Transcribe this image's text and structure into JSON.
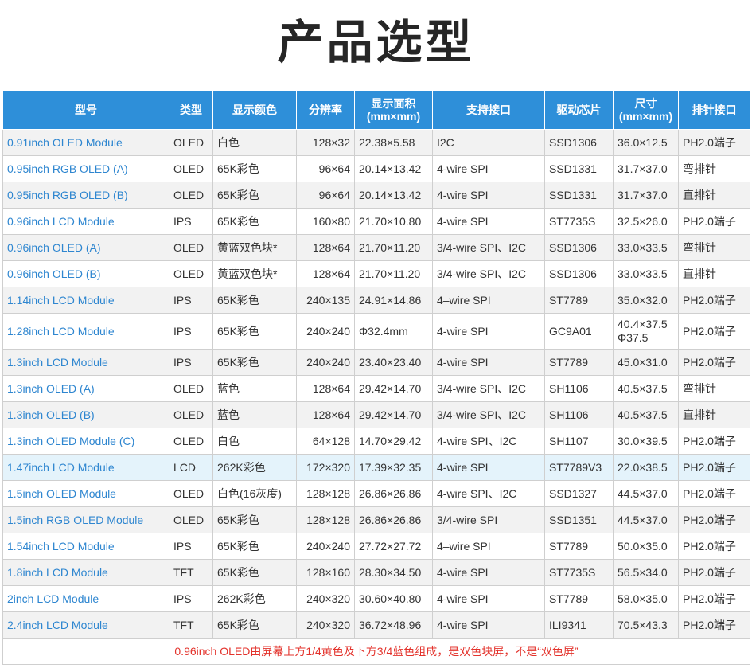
{
  "title": "产品选型",
  "table": {
    "headers": [
      {
        "line1": "型号",
        "line2": ""
      },
      {
        "line1": "类型",
        "line2": ""
      },
      {
        "line1": "显示颜色",
        "line2": ""
      },
      {
        "line1": "分辨率",
        "line2": ""
      },
      {
        "line1": "显示面积",
        "line2": "(mm×mm)"
      },
      {
        "line1": "支持接口",
        "line2": ""
      },
      {
        "line1": "驱动芯片",
        "line2": ""
      },
      {
        "line1": "尺寸",
        "line2": "(mm×mm)"
      },
      {
        "line1": "排针接口",
        "line2": ""
      }
    ],
    "rows": [
      {
        "model": "0.91inch OLED Module",
        "type": "OLED",
        "color": "白色",
        "resolution": "128×32",
        "area": "22.38×5.58",
        "interface": "I2C",
        "driver": "SSD1306",
        "size": "36.0×12.5",
        "connector": "PH2.0端子"
      },
      {
        "model": "0.95inch RGB OLED (A)",
        "type": "OLED",
        "color": "65K彩色",
        "resolution": "96×64",
        "area": "20.14×13.42",
        "interface": "4-wire SPI",
        "driver": "SSD1331",
        "size": "31.7×37.0",
        "connector": "弯排针"
      },
      {
        "model": "0.95inch RGB OLED (B)",
        "type": "OLED",
        "color": "65K彩色",
        "resolution": "96×64",
        "area": "20.14×13.42",
        "interface": "4-wire SPI",
        "driver": "SSD1331",
        "size": "31.7×37.0",
        "connector": "直排针"
      },
      {
        "model": "0.96inch LCD Module",
        "type": "IPS",
        "color": "65K彩色",
        "resolution": "160×80",
        "area": "21.70×10.80",
        "interface": "4-wire SPI",
        "driver": "ST7735S",
        "size": "32.5×26.0",
        "connector": "PH2.0端子"
      },
      {
        "model": "0.96inch OLED (A)",
        "type": "OLED",
        "color": "黄蓝双色块*",
        "resolution": "128×64",
        "area": "21.70×11.20",
        "interface": "3/4-wire SPI、I2C",
        "driver": "SSD1306",
        "size": "33.0×33.5",
        "connector": "弯排针"
      },
      {
        "model": "0.96inch OLED (B)",
        "type": "OLED",
        "color": "黄蓝双色块*",
        "resolution": "128×64",
        "area": "21.70×11.20",
        "interface": "3/4-wire SPI、I2C",
        "driver": "SSD1306",
        "size": "33.0×33.5",
        "connector": "直排针"
      },
      {
        "model": "1.14inch LCD Module",
        "type": "IPS",
        "color": "65K彩色",
        "resolution": "240×135",
        "area": "24.91×14.86",
        "interface": "4–wire SPI",
        "driver": "ST7789",
        "size": "35.0×32.0",
        "connector": "PH2.0端子"
      },
      {
        "model": "1.28inch LCD Module",
        "type": "IPS",
        "color": "65K彩色",
        "resolution": "240×240",
        "area": "Φ32.4mm",
        "interface": "4-wire SPI",
        "driver": "GC9A01",
        "size": "40.4×37.5 Φ37.5",
        "connector": "PH2.0端子"
      },
      {
        "model": "1.3inch LCD Module",
        "type": "IPS",
        "color": "65K彩色",
        "resolution": "240×240",
        "area": "23.40×23.40",
        "interface": "4-wire SPI",
        "driver": "ST7789",
        "size": "45.0×31.0",
        "connector": "PH2.0端子"
      },
      {
        "model": "1.3inch OLED (A)",
        "type": "OLED",
        "color": "蓝色",
        "resolution": "128×64",
        "area": "29.42×14.70",
        "interface": "3/4-wire SPI、I2C",
        "driver": "SH1106",
        "size": "40.5×37.5",
        "connector": "弯排针"
      },
      {
        "model": "1.3inch OLED (B)",
        "type": "OLED",
        "color": "蓝色",
        "resolution": "128×64",
        "area": "29.42×14.70",
        "interface": "3/4-wire SPI、I2C",
        "driver": "SH1106",
        "size": "40.5×37.5",
        "connector": "直排针"
      },
      {
        "model": "1.3inch OLED Module (C)",
        "type": "OLED",
        "color": "白色",
        "resolution": "64×128",
        "area": "14.70×29.42",
        "interface": "4-wire SPI、I2C",
        "driver": "SH1107",
        "size": "30.0×39.5",
        "connector": "PH2.0端子"
      },
      {
        "model": "1.47inch LCD Module",
        "type": "LCD",
        "color": "262K彩色",
        "resolution": "172×320",
        "area": "17.39×32.35",
        "interface": "4-wire SPI",
        "driver": "ST7789V3",
        "size": "22.0×38.5",
        "connector": "PH2.0端子"
      },
      {
        "model": "1.5inch OLED Module",
        "type": "OLED",
        "color": "白色(16灰度)",
        "resolution": "128×128",
        "area": "26.86×26.86",
        "interface": "4-wire SPI、I2C",
        "driver": "SSD1327",
        "size": "44.5×37.0",
        "connector": "PH2.0端子"
      },
      {
        "model": "1.5inch RGB OLED Module",
        "type": "OLED",
        "color": "65K彩色",
        "resolution": "128×128",
        "area": "26.86×26.86",
        "interface": "3/4-wire SPI",
        "driver": "SSD1351",
        "size": "44.5×37.0",
        "connector": "PH2.0端子"
      },
      {
        "model": "1.54inch LCD Module",
        "type": "IPS",
        "color": "65K彩色",
        "resolution": "240×240",
        "area": "27.72×27.72",
        "interface": "4–wire SPI",
        "driver": "ST7789",
        "size": "50.0×35.0",
        "connector": "PH2.0端子"
      },
      {
        "model": "1.8inch LCD Module",
        "type": "TFT",
        "color": "65K彩色",
        "resolution": "128×160",
        "area": "28.30×34.50",
        "interface": "4-wire SPI",
        "driver": "ST7735S",
        "size": "56.5×34.0",
        "connector": "PH2.0端子"
      },
      {
        "model": "2inch LCD Module",
        "type": "IPS",
        "color": "262K彩色",
        "resolution": "240×320",
        "area": "30.60×40.80",
        "interface": "4-wire SPI",
        "driver": "ST7789",
        "size": "58.0×35.0",
        "connector": "PH2.0端子"
      },
      {
        "model": "2.4inch LCD Module",
        "type": "TFT",
        "color": "65K彩色",
        "resolution": "240×320",
        "area": "36.72×48.96",
        "interface": "4-wire SPI",
        "driver": "ILI9341",
        "size": "70.5×43.3",
        "connector": "PH2.0端子"
      }
    ],
    "note": "0.96inch OLED由屏幕上方1/4黄色及下方3/4蓝色组成，是双色块屏，不是“双色屏”"
  },
  "colors": {
    "header_bg": "#2e8fd9",
    "model_link": "#2e86d0",
    "highlight_row": "#e4f3fb",
    "note_text": "#e3322b"
  }
}
